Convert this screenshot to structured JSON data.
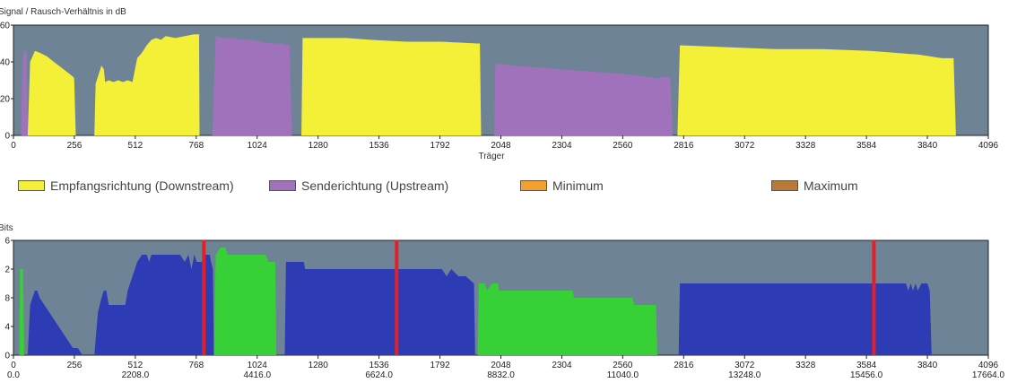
{
  "colors": {
    "plot_bg": "#6f8396",
    "downstream": "#f4ef37",
    "upstream": "#a072bc",
    "minimum": "#f2a02e",
    "maximum": "#b87a36",
    "bits_downstream": "#2d3bb4",
    "bits_upstream": "#37d036",
    "marker": "#e3202a"
  },
  "legend": [
    {
      "label": "Empfangsrichtung (Downstream)",
      "color_key": "downstream"
    },
    {
      "label": "Senderichtung (Upstream)",
      "color_key": "upstream"
    },
    {
      "label": "Minimum",
      "color_key": "minimum"
    },
    {
      "label": "Maximum",
      "color_key": "maximum"
    }
  ],
  "chart_data": [
    {
      "type": "area",
      "ylabel": "Signal / Rausch-Verhältnis in dB",
      "xlabel": "Träger",
      "xlim": [
        0,
        4096
      ],
      "ylim": [
        0,
        60
      ],
      "y_ticks": [
        "0",
        "20",
        "40",
        "60"
      ],
      "x_ticks": [
        "0",
        "256",
        "512",
        "768",
        "1024",
        "1280",
        "1536",
        "1792",
        "2048",
        "2304",
        "2560",
        "2816",
        "3072",
        "3328",
        "3584",
        "3840",
        "4096"
      ],
      "series": [
        {
          "color_key": "upstream",
          "points": [
            [
              32,
              0
            ],
            [
              38,
              40
            ],
            [
              45,
              45
            ],
            [
              55,
              47
            ],
            [
              60,
              0
            ]
          ]
        },
        {
          "color_key": "downstream",
          "points": [
            [
              60,
              0
            ],
            [
              70,
              40
            ],
            [
              90,
              46
            ],
            [
              110,
              45
            ],
            [
              140,
              43
            ],
            [
              170,
              40
            ],
            [
              200,
              37
            ],
            [
              230,
              34
            ],
            [
              250,
              32
            ],
            [
              255,
              31
            ],
            [
              262,
              0
            ]
          ]
        },
        {
          "color_key": "downstream",
          "points": [
            [
              340,
              0
            ],
            [
              345,
              28
            ],
            [
              360,
              34
            ],
            [
              370,
              38
            ],
            [
              380,
              36
            ],
            [
              385,
              29
            ],
            [
              400,
              30
            ],
            [
              420,
              29
            ],
            [
              440,
              30
            ],
            [
              460,
              29
            ],
            [
              480,
              30
            ],
            [
              500,
              29
            ],
            [
              520,
              42
            ],
            [
              540,
              45
            ],
            [
              560,
              49
            ],
            [
              580,
              52
            ],
            [
              600,
              53
            ],
            [
              620,
              52
            ],
            [
              640,
              54
            ],
            [
              680,
              53
            ],
            [
              720,
              54
            ],
            [
              760,
              55
            ],
            [
              780,
              55
            ],
            [
              782,
              0
            ]
          ]
        },
        {
          "color_key": "upstream",
          "points": [
            [
              835,
              0
            ],
            [
              850,
              54
            ],
            [
              880,
              53
            ],
            [
              920,
              53
            ],
            [
              960,
              52
            ],
            [
              1000,
              52
            ],
            [
              1040,
              51
            ],
            [
              1080,
              50
            ],
            [
              1120,
              50
            ],
            [
              1160,
              49
            ],
            [
              1170,
              0
            ]
          ]
        },
        {
          "color_key": "downstream",
          "points": [
            [
              1210,
              0
            ],
            [
              1215,
              53
            ],
            [
              1400,
              53
            ],
            [
              1500,
              52
            ],
            [
              1650,
              51
            ],
            [
              1800,
              51
            ],
            [
              1950,
              50
            ],
            [
              1960,
              50
            ],
            [
              1965,
              0
            ]
          ]
        },
        {
          "color_key": "upstream",
          "points": [
            [
              2020,
              0
            ],
            [
              2025,
              39
            ],
            [
              2100,
              38
            ],
            [
              2200,
              37
            ],
            [
              2300,
              36
            ],
            [
              2400,
              35
            ],
            [
              2500,
              34
            ],
            [
              2600,
              33
            ],
            [
              2700,
              31
            ],
            [
              2750,
              32
            ],
            [
              2760,
              31
            ],
            [
              2770,
              0
            ]
          ]
        },
        {
          "color_key": "downstream",
          "points": [
            [
              2790,
              0
            ],
            [
              2800,
              49
            ],
            [
              3000,
              48
            ],
            [
              3200,
              47
            ],
            [
              3400,
              47
            ],
            [
              3600,
              46
            ],
            [
              3700,
              45
            ],
            [
              3800,
              44
            ],
            [
              3850,
              43
            ],
            [
              3900,
              42
            ],
            [
              3950,
              42
            ],
            [
              3960,
              0
            ]
          ]
        }
      ]
    },
    {
      "type": "area",
      "ylabel": "Bits",
      "xlim": [
        0,
        4096
      ],
      "ylim": [
        0,
        16
      ],
      "y_ticks": [
        "0",
        "4",
        "8",
        "12",
        "16"
      ],
      "y_tick_labels": [
        "0",
        "4",
        "8",
        "2",
        "6"
      ],
      "x_ticks": [
        "0",
        "256",
        "512",
        "768",
        "1024",
        "1280",
        "1536",
        "1792",
        "2048",
        "2304",
        "2560",
        "2816",
        "3072",
        "3328",
        "3584",
        "3840",
        "4096"
      ],
      "x_ticks_secondary": [
        "0.0",
        "2208.0",
        "4416.0",
        "6624.0",
        "8832.0",
        "11040.0",
        "13248.0",
        "15456.0",
        "17664.0"
      ],
      "x_ticks_secondary_at": [
        0,
        512,
        1024,
        1536,
        2048,
        2560,
        3072,
        3584,
        4096
      ],
      "series": [
        {
          "color_key": "bits_upstream",
          "points": [
            [
              25,
              0
            ],
            [
              28,
              12
            ],
            [
              40,
              12
            ],
            [
              45,
              0
            ]
          ]
        },
        {
          "color_key": "bits_downstream",
          "points": [
            [
              60,
              0
            ],
            [
              70,
              7
            ],
            [
              80,
              8
            ],
            [
              90,
              9
            ],
            [
              100,
              9
            ],
            [
              110,
              8
            ],
            [
              130,
              7
            ],
            [
              150,
              6
            ],
            [
              170,
              5
            ],
            [
              190,
              4
            ],
            [
              210,
              3
            ],
            [
              230,
              2
            ],
            [
              250,
              1
            ],
            [
              270,
              1
            ],
            [
              290,
              0
            ]
          ]
        },
        {
          "color_key": "bits_downstream",
          "points": [
            [
              340,
              0
            ],
            [
              355,
              6
            ],
            [
              370,
              8
            ],
            [
              380,
              9
            ],
            [
              390,
              9
            ],
            [
              400,
              7
            ],
            [
              470,
              7
            ],
            [
              480,
              9
            ],
            [
              500,
              11
            ],
            [
              520,
              13
            ],
            [
              540,
              14
            ],
            [
              560,
              14
            ],
            [
              570,
              13
            ],
            [
              580,
              14
            ],
            [
              700,
              14
            ],
            [
              720,
              13
            ],
            [
              735,
              14
            ],
            [
              748,
              12
            ],
            [
              760,
              14
            ],
            [
              770,
              13
            ],
            [
              790,
              13
            ],
            [
              805,
              14
            ],
            [
              825,
              14
            ],
            [
              830,
              13
            ],
            [
              838,
              12
            ],
            [
              842,
              0
            ]
          ]
        },
        {
          "color_key": "bits_upstream",
          "points": [
            [
              842,
              0
            ],
            [
              850,
              14
            ],
            [
              870,
              15
            ],
            [
              890,
              15
            ],
            [
              900,
              14
            ],
            [
              1060,
              14
            ],
            [
              1070,
              13
            ],
            [
              1100,
              13
            ],
            [
              1105,
              0
            ]
          ]
        },
        {
          "color_key": "bits_downstream",
          "points": [
            [
              1140,
              0
            ],
            [
              1145,
              13
            ],
            [
              1220,
              13
            ],
            [
              1225,
              12
            ],
            [
              1800,
              12
            ],
            [
              1820,
              11
            ],
            [
              1840,
              12
            ],
            [
              1870,
              11
            ],
            [
              1900,
              11
            ],
            [
              1935,
              10
            ],
            [
              1940,
              0
            ]
          ]
        },
        {
          "color_key": "bits_upstream",
          "points": [
            [
              1950,
              0
            ],
            [
              1955,
              10
            ],
            [
              1980,
              10
            ],
            [
              1990,
              9
            ],
            [
              2010,
              10
            ],
            [
              2035,
              10
            ],
            [
              2040,
              9
            ],
            [
              2350,
              9
            ],
            [
              2355,
              8
            ],
            [
              2600,
              8
            ],
            [
              2610,
              7
            ],
            [
              2690,
              7
            ],
            [
              2700,
              7
            ],
            [
              2705,
              0
            ]
          ]
        },
        {
          "color_key": "bits_downstream",
          "points": [
            [
              2795,
              0
            ],
            [
              2800,
              10
            ],
            [
              3000,
              10
            ],
            [
              3500,
              10
            ],
            [
              3750,
              10
            ],
            [
              3760,
              9
            ],
            [
              3770,
              10
            ],
            [
              3780,
              9
            ],
            [
              3790,
              10
            ],
            [
              3800,
              9
            ],
            [
              3815,
              10
            ],
            [
              3840,
              10
            ],
            [
              3850,
              9
            ],
            [
              3858,
              0
            ]
          ]
        }
      ],
      "markers": [
        800,
        1610,
        3615
      ]
    }
  ]
}
